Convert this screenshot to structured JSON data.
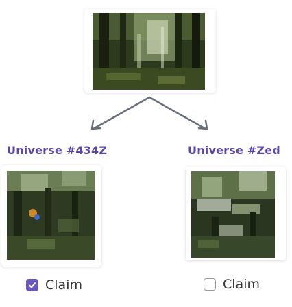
{
  "branches": [
    {
      "title": "Universe #434Z",
      "claim": {
        "label": "Claim",
        "checked": true
      }
    },
    {
      "title": "Universe #Zed",
      "claim": {
        "label": "Claim",
        "checked": false
      }
    }
  ],
  "colors": {
    "accent": "#5c48a8",
    "checkbox_checked": "#6a55b8",
    "branch_line": "#666f79"
  }
}
